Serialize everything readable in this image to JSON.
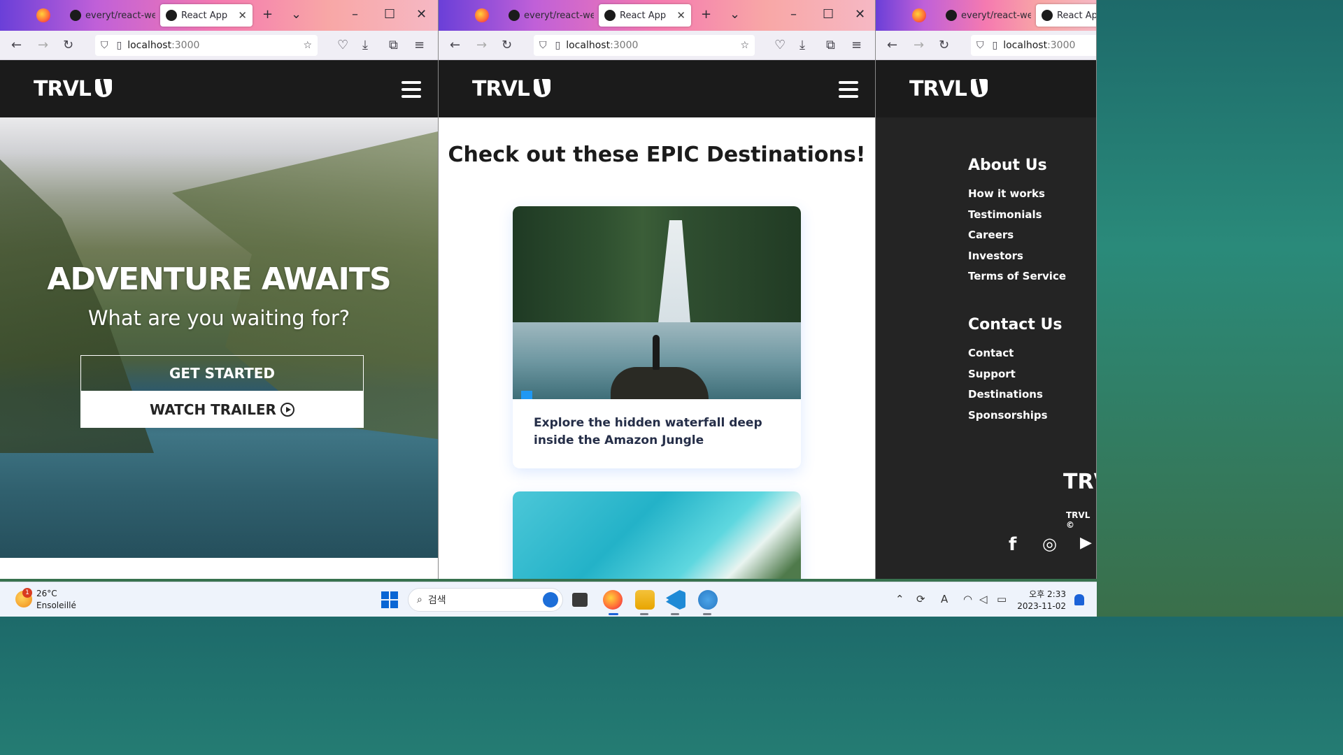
{
  "browser": {
    "tab_inactive_label": "everyt/react-web",
    "tab_active_label": "React App",
    "url_host": "localhost",
    "url_port": ":3000"
  },
  "site": {
    "logo": "TRVL"
  },
  "hero": {
    "title": "ADVENTURE AWAITS",
    "subtitle": "What are you waiting for?",
    "get_started": "GET STARTED",
    "watch_trailer": "WATCH TRAILER"
  },
  "cards": {
    "title": "Check out these EPIC Destinations!",
    "items": [
      {
        "text": "Explore the hidden waterfall deep inside the Amazon Jungle"
      }
    ]
  },
  "footer": {
    "about_title": "About Us",
    "about_links": [
      "How it works",
      "Testimonials",
      "Careers",
      "Investors",
      "Terms of Service"
    ],
    "contact_title": "Contact Us",
    "contact_links": [
      "Contact",
      "Support",
      "Destinations",
      "Sponsorships"
    ],
    "logo": "TRV",
    "copyright": "TRVL ©",
    "social_icons": [
      "facebook-icon",
      "instagram-icon",
      "youtube-icon"
    ]
  },
  "taskbar": {
    "weather_badge": "1",
    "temperature": "26°C",
    "weather": "Ensoleillé",
    "search_placeholder": "검색",
    "time": "오후 2:33",
    "date": "2023-11-02"
  }
}
